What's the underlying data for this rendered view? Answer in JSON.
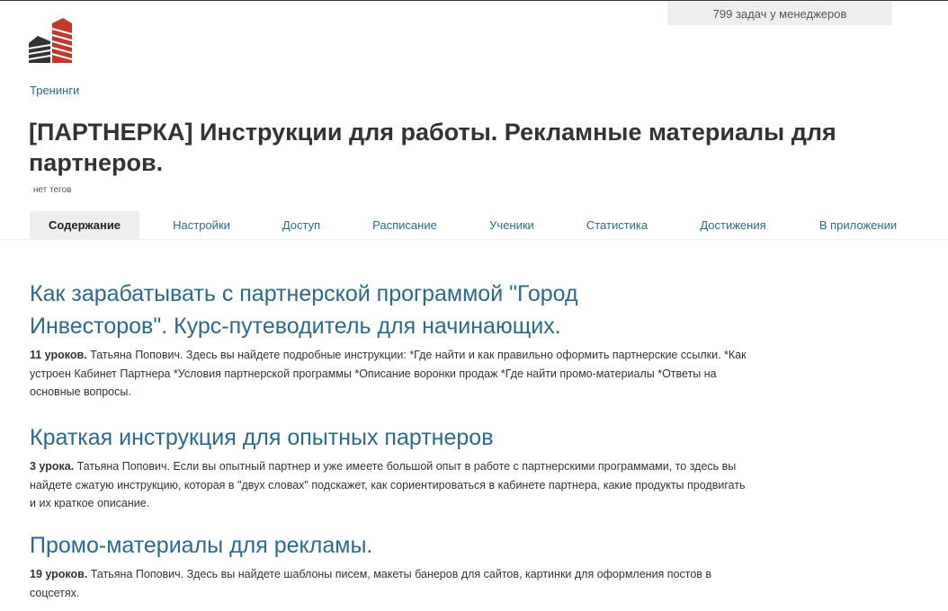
{
  "header": {
    "tasks_badge": "799 задач у менеджеров"
  },
  "breadcrumb": "Тренинги",
  "page": {
    "title": "[ПАРТНЕРКА] Инструкции для работы. Рекламные материалы для партнеров.",
    "tags": "нет тегов"
  },
  "tabs": [
    {
      "label": "Содержание",
      "active": true
    },
    {
      "label": "Настройки"
    },
    {
      "label": "Доступ"
    },
    {
      "label": "Расписание"
    },
    {
      "label": "Ученики"
    },
    {
      "label": "Статистика"
    },
    {
      "label": "Достижения"
    },
    {
      "label": "В приложении"
    }
  ],
  "trainings": [
    {
      "title": "Как зарабатывать с партнерской программой \"Город Инвесторов\". Курс-путеводитель для начинающих.",
      "lessons": "11 уроков.",
      "description": " Татьяна Попович. Здесь вы найдете подробные инструкции: *Где найти и как правильно оформить партнерские ссылки. *Как устроен Кабинет Партнера *Условия партнерской программы *Описание воронки продаж *Где найти промо-материалы *Ответы на основные вопросы."
    },
    {
      "title": "Краткая инструкция для опытных партнеров",
      "lessons": "3 урока.",
      "description": " Татьяна Попович. Если вы опытный партнер и уже имеете большой опыт в работе с партнерскими программами, то здесь вы найдете сжатую инструкцию, которая в \"двух словах\" подскажет, как сориентироваться в кабинете партнера, какие продукты продвигать и их краткое описание."
    },
    {
      "title": "Промо-материалы для рекламы.",
      "lessons": "19 уроков.",
      "description": " Татьяна Попович. Здесь вы найдете шаблоны писем, макеты банеров для сайтов, картинки для оформления постов в соцсетях."
    }
  ],
  "colors": {
    "link": "#2b6a8e",
    "active_tab_bg": "#eeeeee",
    "logo_red": "#c0392b",
    "logo_dark": "#333333"
  }
}
